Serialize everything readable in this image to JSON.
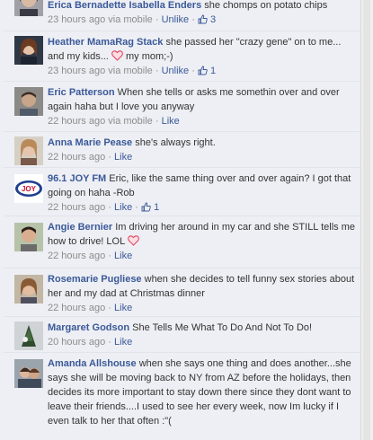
{
  "comments": [
    {
      "author": "Erica Bernadette Isabella Enders",
      "text": "she chomps on potato chips",
      "time": "23 hours ago via mobile",
      "action": "Unlike",
      "likes": "3"
    },
    {
      "author": "Heather MamaRag Stack",
      "text": "she passed her \"crazy gene\" on to me... and my kids...",
      "text_after": "my mom;-)",
      "time": "23 hours ago via mobile",
      "action": "Unlike",
      "likes": "1"
    },
    {
      "author": "Eric Patterson",
      "text": "When she tells or asks me somethin over and over again haha but I love you anyway",
      "time": "22 hours ago via mobile",
      "action": "Like"
    },
    {
      "author": "Anna Marie Pease",
      "text": "she's always right.",
      "time": "22 hours ago",
      "action": "Like"
    },
    {
      "author": "96.1 JOY FM",
      "text": "Eric, like the same thing over and over again? I got that going on haha -Rob",
      "time": "22 hours ago",
      "action": "Like",
      "likes": "1",
      "logo_text": "96.1 JOYfm"
    },
    {
      "author": "Angie Bernier",
      "text": "Im driving her around in my car and she STILL tells me how to drive! LOL",
      "time": "22 hours ago",
      "action": "Like"
    },
    {
      "author": "Rosemarie Pugliese",
      "text": "when she decides to tell funny sex stories about her and my dad at Christmas dinner",
      "time": "22 hours ago",
      "action": "Like"
    },
    {
      "author": "Margaret Godson",
      "text": "She Tells Me What To Do And Not To Do!",
      "time": "20 hours ago",
      "action": "Like"
    },
    {
      "author": "Amanda Allshouse",
      "text": "when she says one thing and does another...she says she will be moving back to NY from AZ before the holidays, then decides its more important to stay down there since they dont want to leave their friends....I used to see her every week, now Im lucky if I even talk to her that often :\"("
    }
  ],
  "colors": {
    "link": "#3b5998",
    "meta": "#8c8c8c",
    "background": "#edeff4",
    "heart": "#e0425e"
  },
  "icons": {
    "like": "thumbs-up-icon",
    "heart": "heart-emoticon-icon"
  }
}
